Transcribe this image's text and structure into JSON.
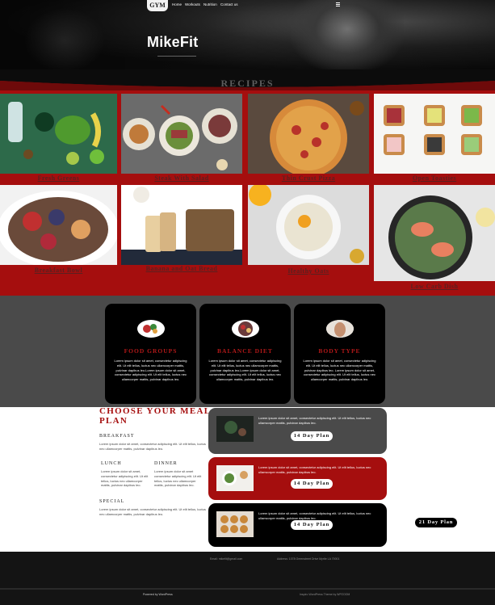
{
  "site": {
    "logo_text": "GYM",
    "hero_title": "MikeFit",
    "nav": [
      "Home",
      "Workouts",
      "Nutrition",
      "Contact us"
    ]
  },
  "recipes": {
    "title": "RECIPES",
    "items": [
      {
        "label": "Fresh Greens"
      },
      {
        "label": "Steak With Salad"
      },
      {
        "label": "Thin Crust Pizza"
      },
      {
        "label": "Open Toasties"
      },
      {
        "label": "Breakfast Bowl"
      },
      {
        "label": "Banana and Oat Bread"
      },
      {
        "label": "Healthy Oats"
      },
      {
        "label": "Low Carb Dish"
      }
    ]
  },
  "features": [
    {
      "title": "FOOD GROUPS",
      "body": "Lorem ipsum dolor sit amet, consectetur adipiscing elit. Ut elit tellus, luctus nec ullamcorper mattis, pulvinar dapibus leo.Lorem ipsum dolor sit amet, consectetur adipiscing elit. Ut elit tellus, luctus nec ullamcorper mattis, pulvinar dapibus leo."
    },
    {
      "title": "BALANCE DIET",
      "body": "Lorem ipsum dolor sit amet, consectetur adipiscing elit. Ut elit tellus, luctus nec ullamcorper mattis, pulvinar dapibus leo.Lorem ipsum dolor sit amet, consectetur adipiscing elit. Ut elit tellus, luctus nec ullamcorper mattis, pulvinar dapibus leo."
    },
    {
      "title": "BODY TYPE",
      "body": "Lorem ipsum dolor sit amet, consectetur adipiscing elit. Ut elit tellus, luctus nec ullamcorper mattis, pulvinar dapibus leo. Lorem ipsum dolor sit amet, consectetur adipiscing elit. Ut elit tellus, luctus nec ullamcorper mattis, pulvinar dapibus leo."
    }
  ],
  "meal_plan": {
    "title": "CHOOSE YOUR MEAL PLAN",
    "breakfast": {
      "heading": "BREAKFAST",
      "text": "Lorem ipsum dolor sit amet, consectetur adipiscing elit. Ut elit tellus, luctus nec ullamcorper mattis, pulvinar dapibus leo."
    },
    "lunch": {
      "heading": "LUNCH",
      "text": "Lorem ipsum dolor sit amet, consectetur adipiscing elit. Ut elit tellus, luctus nec ullamcorper mattis, pulvinar dapibus leo."
    },
    "dinner": {
      "heading": "DINNER",
      "text": "Lorem ipsum dolor sit amet consectetur adipiscing elit. Ut elit tellus, luctus nec ullamcorper mattis, pulvinar dapibus leo."
    },
    "special": {
      "heading": "SPECIAL",
      "text": "Lorem ipsum dolor sit amet, consectetur adipiscing elit. Ut elit tellus, luctus nec ullamcorper mattis, pulvinar dapibus leo."
    },
    "plans": [
      {
        "text": "Lorem ipsum dolor sit amet, consectetur adipiscing elit. Ut elit tellus, luctus nec ullamcorper mattis, pulvinar dapibus leo.",
        "button": "14 Day Plan"
      },
      {
        "text": "Lorem ipsum dolor sit amet, consectetur adipiscing elit. Ut elit tellus, luctus nec ullamcorper mattis, pulvinar dapibus leo.",
        "button": "14 Day Plan"
      },
      {
        "text": "Lorem ipsum dolor sit amet, consectetur adipiscing elit. Ut elit tellus, luctus nec ullamcorper mattis, pulvinar dapibus leo.",
        "button": "14 Day Plan"
      }
    ],
    "extra_button": "21 Day Plan"
  },
  "footer": {
    "email": "Email: mikefit@gmail.com",
    "address": "Address: 1078 Greenstreet Drive Myrtle LA 70001",
    "powered": "Powered by WordPress",
    "theme": "Inspiro WordPress Theme by WPZOOM"
  },
  "colors": {
    "accent_red": "#a50e0e",
    "dark_gray": "#4a4a4a",
    "black": "#000000"
  }
}
